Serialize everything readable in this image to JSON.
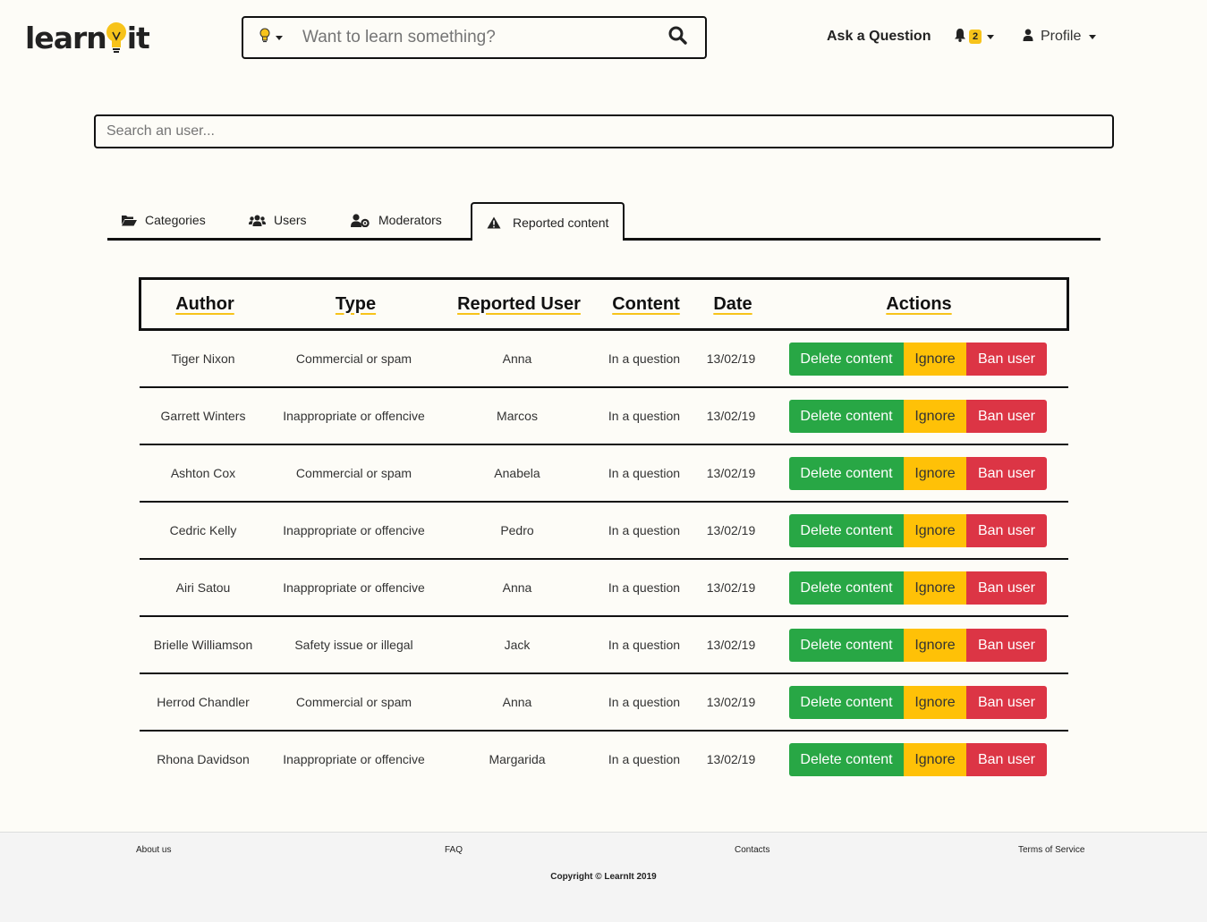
{
  "brand": {
    "name_prefix": "learn",
    "name_suffix": "it"
  },
  "header": {
    "search_placeholder": "Want to learn something?",
    "ask_label": "Ask a Question",
    "notifications_count": "2",
    "profile_label": "Profile"
  },
  "user_search": {
    "placeholder": "Search an user..."
  },
  "tabs": [
    {
      "label": "Categories",
      "icon": "folder-open-icon"
    },
    {
      "label": "Users",
      "icon": "users-icon"
    },
    {
      "label": "Moderators",
      "icon": "user-cog-icon"
    },
    {
      "label": "Reported content",
      "icon": "warning-icon",
      "active": true
    }
  ],
  "table": {
    "headers": [
      "Author",
      "Type",
      "Reported User",
      "Content",
      "Date",
      "Actions"
    ],
    "rows": [
      {
        "author": "Tiger Nixon",
        "type": "Commercial or spam",
        "reported_user": "Anna",
        "content": "In a question",
        "date": "13/02/19"
      },
      {
        "author": "Garrett Winters",
        "type": "Inappropriate or offencive",
        "reported_user": "Marcos",
        "content": "In a question",
        "date": "13/02/19"
      },
      {
        "author": "Ashton Cox",
        "type": "Commercial or spam",
        "reported_user": "Anabela",
        "content": "In a question",
        "date": "13/02/19"
      },
      {
        "author": "Cedric Kelly",
        "type": "Inappropriate or offencive",
        "reported_user": "Pedro",
        "content": "In a question",
        "date": "13/02/19"
      },
      {
        "author": "Airi Satou",
        "type": "Inappropriate or offencive",
        "reported_user": "Anna",
        "content": "In a question",
        "date": "13/02/19"
      },
      {
        "author": "Brielle Williamson",
        "type": "Safety issue or illegal",
        "reported_user": "Jack",
        "content": "In a question",
        "date": "13/02/19"
      },
      {
        "author": "Herrod Chandler",
        "type": "Commercial or spam",
        "reported_user": "Anna",
        "content": "In a question",
        "date": "13/02/19"
      },
      {
        "author": "Rhona Davidson",
        "type": "Inappropriate or offencive",
        "reported_user": "Margarida",
        "content": "In a question",
        "date": "13/02/19"
      }
    ],
    "actions": {
      "delete": "Delete content",
      "ignore": "Ignore",
      "ban": "Ban user"
    }
  },
  "footer": {
    "links": [
      "About us",
      "FAQ",
      "Contacts",
      "Terms of Service"
    ],
    "copyright": "Copyright © LearnIt 2019"
  },
  "colors": {
    "accent": "#f7c31a",
    "delete": "#28a745",
    "ignore": "#ffc107",
    "ban": "#dc3545"
  }
}
